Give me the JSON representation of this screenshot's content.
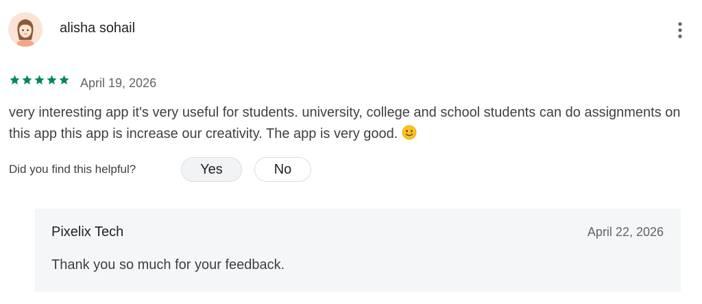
{
  "review": {
    "reviewer_name": "alisha sohail",
    "avatar_icon": "girl-avatar-icon",
    "rating": 5,
    "rating_max": 5,
    "star_color": "#01875f",
    "date": "April 19, 2026",
    "text": "very interesting app it's very useful for students. university, college and school students can do assignments on this app this app is increase our creativity. The app is very good.",
    "emoji_icon": "slightly-smiling-face-icon",
    "more_icon": "more-vert-icon"
  },
  "helpful": {
    "question": "Did you find this helpful?",
    "yes_label": "Yes",
    "no_label": "No"
  },
  "developer_reply": {
    "name": "Pixelix Tech",
    "date": "April 22, 2026",
    "text": "Thank you so much for your feedback."
  }
}
